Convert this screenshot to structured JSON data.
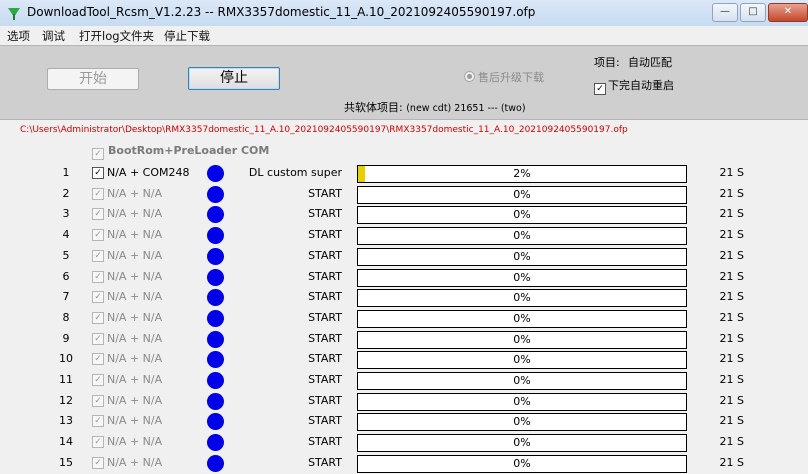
{
  "window": {
    "title": "DownloadTool_Rcsm_V1.2.23  --  RMX3357domestic_11_A.10_2021092405590197.ofp",
    "minimize_glyph": "—",
    "maximize_glyph": "□",
    "close_glyph": "✕"
  },
  "menu": [
    "选项",
    "调试",
    "打开log文件夹",
    "停止下载"
  ],
  "controls": {
    "start_label": "开始",
    "stop_label": "停止",
    "after_sales_label": "售后升级下载",
    "project_label": "项目:",
    "project_value": "自动匹配",
    "auto_reboot_label": "下完自动重启",
    "auto_reboot_checked": true,
    "shared_label": "共软体项目:",
    "shared_info": "(new cdt)  21651  --- (two)"
  },
  "path": "C:\\Users\\Administrator\\Desktop\\RMX3357domestic_11_A.10_2021092405590197\\RMX3357domestic_11_A.10_2021092405590197.ofp",
  "bootrom_label": "BootRom+PreLoader COM",
  "accent_colors": {
    "progress_fill": "#e8d000",
    "status_dot": "#0000e8",
    "path_text": "#d40000"
  },
  "ports": [
    {
      "num": "1",
      "label": "N/A + COM248",
      "active": true,
      "stage": "DL custom super",
      "progress_text": "2%",
      "progress": 0.02,
      "time": "21 S"
    },
    {
      "num": "2",
      "label": "N/A + N/A",
      "active": false,
      "stage": "START",
      "progress_text": "0%",
      "progress": 0,
      "time": "21 S"
    },
    {
      "num": "3",
      "label": "N/A + N/A",
      "active": false,
      "stage": "START",
      "progress_text": "0%",
      "progress": 0,
      "time": "21 S"
    },
    {
      "num": "4",
      "label": "N/A + N/A",
      "active": false,
      "stage": "START",
      "progress_text": "0%",
      "progress": 0,
      "time": "21 S"
    },
    {
      "num": "5",
      "label": "N/A + N/A",
      "active": false,
      "stage": "START",
      "progress_text": "0%",
      "progress": 0,
      "time": "21 S"
    },
    {
      "num": "6",
      "label": "N/A + N/A",
      "active": false,
      "stage": "START",
      "progress_text": "0%",
      "progress": 0,
      "time": "21 S"
    },
    {
      "num": "7",
      "label": "N/A + N/A",
      "active": false,
      "stage": "START",
      "progress_text": "0%",
      "progress": 0,
      "time": "21 S"
    },
    {
      "num": "8",
      "label": "N/A + N/A",
      "active": false,
      "stage": "START",
      "progress_text": "0%",
      "progress": 0,
      "time": "21 S"
    },
    {
      "num": "9",
      "label": "N/A + N/A",
      "active": false,
      "stage": "START",
      "progress_text": "0%",
      "progress": 0,
      "time": "21 S"
    },
    {
      "num": "10",
      "label": "N/A + N/A",
      "active": false,
      "stage": "START",
      "progress_text": "0%",
      "progress": 0,
      "time": "21 S"
    },
    {
      "num": "11",
      "label": "N/A + N/A",
      "active": false,
      "stage": "START",
      "progress_text": "0%",
      "progress": 0,
      "time": "21 S"
    },
    {
      "num": "12",
      "label": "N/A + N/A",
      "active": false,
      "stage": "START",
      "progress_text": "0%",
      "progress": 0,
      "time": "21 S"
    },
    {
      "num": "13",
      "label": "N/A + N/A",
      "active": false,
      "stage": "START",
      "progress_text": "0%",
      "progress": 0,
      "time": "21 S"
    },
    {
      "num": "14",
      "label": "N/A + N/A",
      "active": false,
      "stage": "START",
      "progress_text": "0%",
      "progress": 0,
      "time": "21 S"
    },
    {
      "num": "15",
      "label": "N/A + N/A",
      "active": false,
      "stage": "START",
      "progress_text": "0%",
      "progress": 0,
      "time": "21 S"
    }
  ]
}
